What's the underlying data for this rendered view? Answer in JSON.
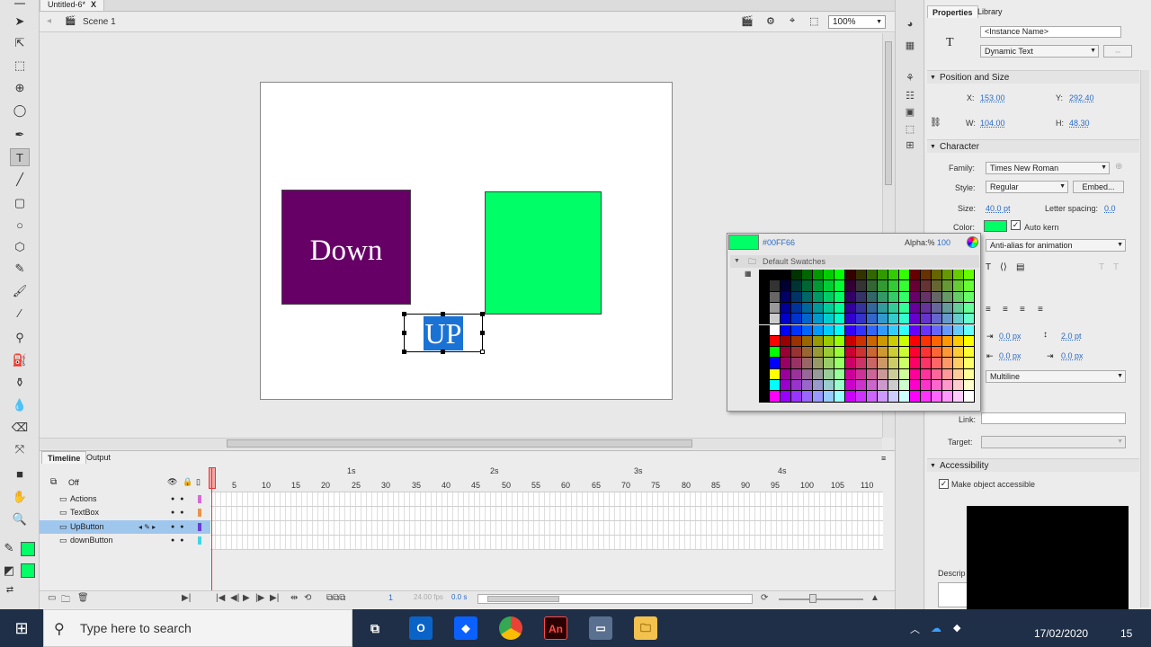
{
  "document": {
    "tab_title": "Untitled-6*",
    "tab_close": "X"
  },
  "editbar": {
    "scene": "Scene 1",
    "zoom": "100%"
  },
  "stage": {
    "down_label": "Down",
    "up_label": "UP",
    "colors": {
      "down": "#660066",
      "green": "#00ff66",
      "selection": "#1a73d4"
    }
  },
  "timeline": {
    "tabs": [
      "Timeline",
      "Output"
    ],
    "onion": "Off",
    "layers": [
      {
        "name": "Actions",
        "color": "#d56ad5",
        "selected": false
      },
      {
        "name": "TextBox",
        "color": "#e9944b",
        "selected": false
      },
      {
        "name": "UpButton",
        "color": "#6b3bd6",
        "selected": true
      },
      {
        "name": "downButton",
        "color": "#3fd7e6",
        "selected": false
      }
    ],
    "ruler_seconds": [
      "1s",
      "2s",
      "3s",
      "4s"
    ],
    "ruler_frames": [
      "5",
      "10",
      "15",
      "20",
      "25",
      "30",
      "35",
      "40",
      "45",
      "50",
      "55",
      "60",
      "65",
      "70",
      "75",
      "80",
      "85",
      "90",
      "95",
      "100",
      "105",
      "110"
    ],
    "current_frame": "1",
    "fps": "24.00 fps",
    "elapsed": "0.0 s"
  },
  "properties": {
    "tabs": [
      "Properties",
      "Library"
    ],
    "instance_placeholder": "<Instance Name>",
    "text_type": "Dynamic Text",
    "position_size": {
      "section": "Position and Size",
      "x_label": "X:",
      "x": "153.00",
      "y_label": "Y:",
      "y": "292.40",
      "w_label": "W:",
      "w": "104.00",
      "h_label": "H:",
      "h": "48.30"
    },
    "character": {
      "section": "Character",
      "family_label": "Family:",
      "family": "Times New Roman",
      "style_label": "Style:",
      "style": "Regular",
      "embed": "Embed...",
      "size_label": "Size:",
      "size": "40.0 pt",
      "spacing_label": "Letter spacing:",
      "spacing": "0.0",
      "color_label": "Color:",
      "color": "#00ff66",
      "auto_kern": "Auto kern",
      "anti_alias": "Anti-alias for animation"
    },
    "paragraph": {
      "indent": "0.0 px",
      "line_spacing": "2.0 pt",
      "left_margin": "0.0 px",
      "right_margin": "0.0 px",
      "behavior": "Multiline"
    },
    "options": {
      "link_label": "Link:",
      "target_label": "Target:"
    },
    "accessibility": {
      "section": "Accessibility",
      "make_accessible": "Make object accessible",
      "description_label": "Descrip"
    }
  },
  "picker": {
    "hex": "#00FF66",
    "alpha_label": "Alpha:%",
    "alpha": "100",
    "swatches_label": "Default Swatches"
  },
  "taskbar": {
    "search_placeholder": "Type here to search",
    "date": "17/02/2020",
    "notification_count": "15"
  }
}
